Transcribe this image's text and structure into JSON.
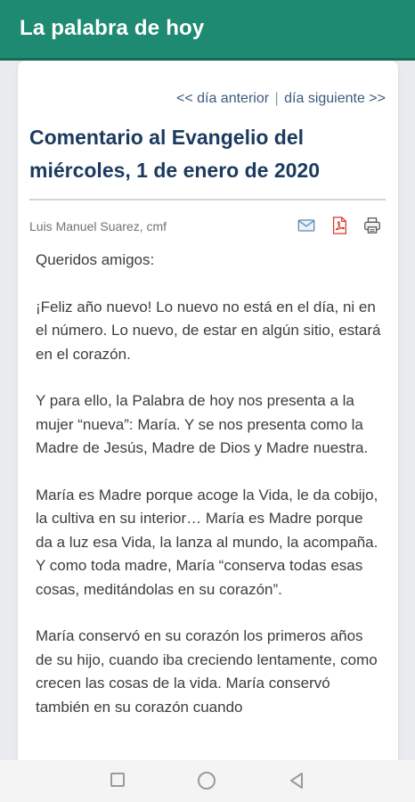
{
  "app": {
    "title": "La palabra de hoy"
  },
  "nav": {
    "prev": "<< día anterior",
    "separator": "|",
    "next": "día siguiente >>"
  },
  "article": {
    "title": "Comentario al Evangelio del miércoles, 1 de enero de 2020",
    "author": "Luis Manuel Suarez, cmf",
    "paragraphs": [
      "Queridos amigos:",
      "¡Feliz año nuevo! Lo nuevo no está en el día, ni en el número. Lo nuevo, de estar en algún sitio, estará en el corazón.",
      "Y para ello, la Palabra de hoy nos presenta a la mujer “nueva”: María. Y se nos presenta como la Madre de Jesús, Madre de Dios y Madre nuestra.",
      "María es Madre porque acoge la Vida, le da cobijo, la cultiva en su interior… María es Madre porque da a luz esa Vida, la lanza al mundo, la acompaña. Y como toda madre, María “conserva todas esas cosas, meditándolas en su corazón”.",
      "María conservó en su corazón los primeros años de su hijo, cuando iba creciendo lentamente, como crecen las cosas de la vida. María conservó también en su corazón cuando"
    ]
  },
  "tools": {
    "email": "email-icon",
    "pdf": "pdf-icon",
    "print": "print-icon"
  },
  "colors": {
    "appbar": "#1f8a72",
    "title": "#1c3a5f",
    "link": "#3a5b7e",
    "pdf": "#d9382f"
  }
}
